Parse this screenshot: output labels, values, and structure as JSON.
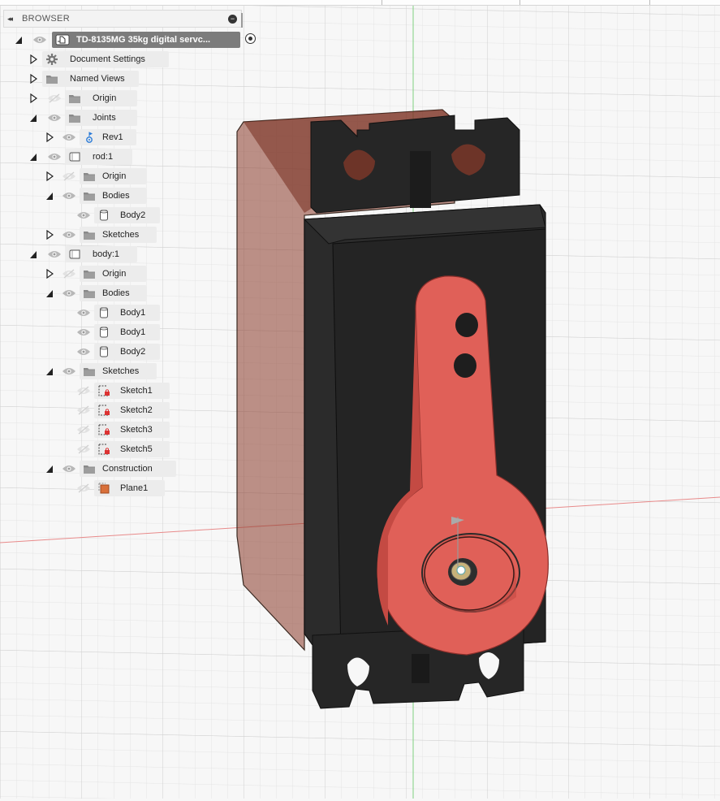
{
  "browser": {
    "collapse_glyph": "◂◂",
    "title": "BROWSER",
    "minimize_glyph": "−"
  },
  "tree": [
    {
      "label": "TD-8135MG 35kg digital servc...",
      "icon": "component-root-icon",
      "expander": "expanded",
      "eye": "visible",
      "depth": 0,
      "active": true
    },
    {
      "label": "Document Settings",
      "icon": "gear-icon",
      "expander": "collapsed",
      "eye": "none",
      "depth": 1
    },
    {
      "label": "Named Views",
      "icon": "folder-icon",
      "expander": "collapsed",
      "eye": "none",
      "depth": 1
    },
    {
      "label": "Origin",
      "icon": "folder-icon",
      "expander": "collapsed",
      "eye": "hidden",
      "depth": 1
    },
    {
      "label": "Joints",
      "icon": "folder-icon",
      "expander": "expanded",
      "eye": "visible",
      "depth": 1
    },
    {
      "label": "Rev1",
      "icon": "revolute-joint-icon",
      "expander": "collapsed",
      "eye": "visible",
      "depth": 2
    },
    {
      "label": "rod:1",
      "icon": "component-icon",
      "expander": "expanded",
      "eye": "visible",
      "depth": 1
    },
    {
      "label": "Origin",
      "icon": "folder-icon",
      "expander": "collapsed",
      "eye": "hidden",
      "depth": 2
    },
    {
      "label": "Bodies",
      "icon": "folder-icon",
      "expander": "expanded",
      "eye": "visible",
      "depth": 2
    },
    {
      "label": "Body2",
      "icon": "body-icon",
      "expander": "none",
      "eye": "visible",
      "depth": 3
    },
    {
      "label": "Sketches",
      "icon": "folder-icon",
      "expander": "collapsed",
      "eye": "visible",
      "depth": 2
    },
    {
      "label": "body:1",
      "icon": "component-icon",
      "expander": "expanded",
      "eye": "visible",
      "depth": 1
    },
    {
      "label": "Origin",
      "icon": "folder-icon",
      "expander": "collapsed",
      "eye": "hidden",
      "depth": 2
    },
    {
      "label": "Bodies",
      "icon": "folder-icon",
      "expander": "expanded",
      "eye": "visible",
      "depth": 2
    },
    {
      "label": "Body1",
      "icon": "body-icon",
      "expander": "none",
      "eye": "visible",
      "depth": 3
    },
    {
      "label": "Body1",
      "icon": "body-icon",
      "expander": "none",
      "eye": "visible",
      "depth": 3
    },
    {
      "label": "Body2",
      "icon": "body-icon",
      "expander": "none",
      "eye": "visible",
      "depth": 3
    },
    {
      "label": "Sketches",
      "icon": "folder-icon",
      "expander": "expanded",
      "eye": "visible",
      "depth": 2
    },
    {
      "label": "Sketch1",
      "icon": "sketch-icon",
      "expander": "none",
      "eye": "hidden",
      "depth": 3
    },
    {
      "label": "Sketch2",
      "icon": "sketch-icon",
      "expander": "none",
      "eye": "hidden",
      "depth": 3
    },
    {
      "label": "Sketch3",
      "icon": "sketch-icon",
      "expander": "none",
      "eye": "hidden",
      "depth": 3
    },
    {
      "label": "Sketch5",
      "icon": "sketch-icon",
      "expander": "none",
      "eye": "hidden",
      "depth": 3
    },
    {
      "label": "Construction",
      "icon": "folder-icon",
      "expander": "expanded",
      "eye": "visible",
      "depth": 2
    },
    {
      "label": "Plane1",
      "icon": "plane-icon",
      "expander": "none",
      "eye": "hidden",
      "depth": 3
    }
  ],
  "colors": {
    "canvas_bg": "#f7f7f7",
    "grid_minor": "#e4e4e4",
    "grid_major": "#cfcfcf",
    "x_axis": "#e88a8a",
    "y_axis": "#7fd07f",
    "servo_body": "#2a2a2a",
    "servo_translucent": "#8b3a2a",
    "servo_horn": "#e06058",
    "tree_box": "#ececec",
    "tree_box_active": "#7c7c7c"
  }
}
